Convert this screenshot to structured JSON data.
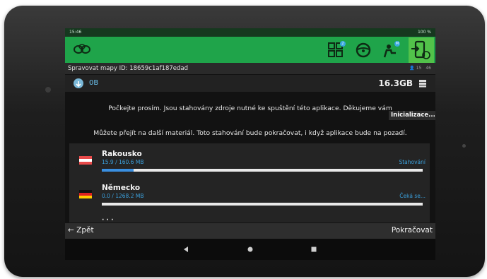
{
  "status_bar": {
    "time": "15:46",
    "right": "100 %"
  },
  "app_bar": {
    "badges": {
      "maps": "2",
      "share": "M"
    },
    "colors": {
      "bar": "#1fa44a",
      "active": "#52c24a"
    }
  },
  "subheader": {
    "title": "Spravovat mapy ID: 18659c1af187edad",
    "hour": "15",
    "minute": "46"
  },
  "storage": {
    "left_value": "0B",
    "right_value": "16.3GB"
  },
  "messages": {
    "wait": "Počkejte prosím. Jsou stahovány zdroje nutné ke spuštění této aplikace. Děkujeme vám",
    "init": "Inicializace...",
    "background": "Můžete přejít na další materiál. Toto stahování bude pokračovat, i když aplikace bude na pozadí."
  },
  "downloads": [
    {
      "country": "Rakousko",
      "size": "15.9 / 160.6 MB",
      "status": "Stahování",
      "progress": 0.099
    },
    {
      "country": "Německo",
      "size": "0.0 / 1268.2 MB",
      "status": "Čeká se...",
      "progress": 0.0
    }
  ],
  "footer": {
    "back": "← Zpět",
    "continue": "Pokračovat"
  },
  "icons": {
    "logo": "app-logo-icon",
    "maps": "maps-download-icon",
    "steering": "steering-wheel-icon",
    "share": "share-person-icon",
    "login": "login-device-icon",
    "storage": "database-icon"
  }
}
